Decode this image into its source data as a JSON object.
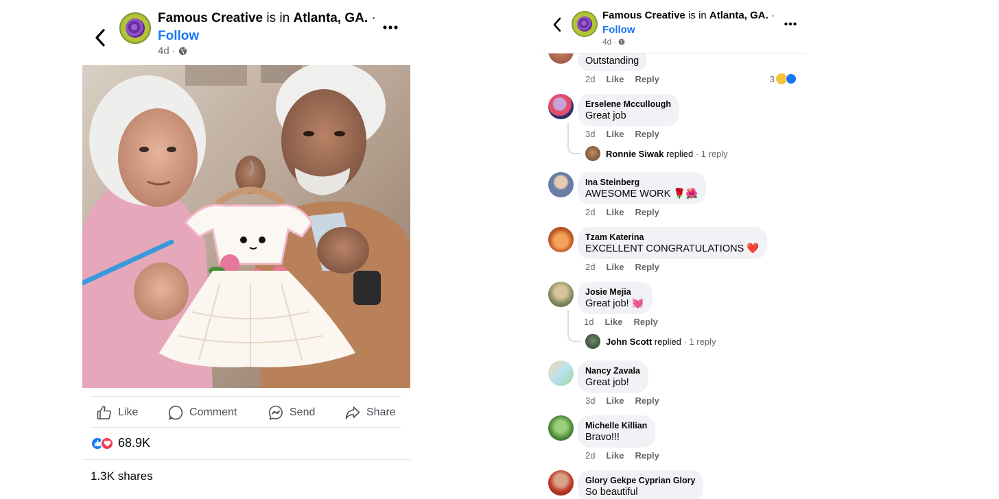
{
  "post": {
    "author": "Famous Creative",
    "location_prefix": "is in",
    "location": "Atlanta, GA.",
    "dot": "·",
    "follow_label": "Follow",
    "time": "4d",
    "dot2": "·",
    "actions": {
      "like": "Like",
      "comment": "Comment",
      "send": "Send",
      "share": "Share"
    },
    "reaction_count": "68.9K",
    "shares": "1.3K shares"
  },
  "comments_panel": {
    "header": {
      "author": "Famous Creative",
      "location_prefix": "is in",
      "location": "Atlanta, GA.",
      "dot": "·",
      "follow_label": "Follow",
      "time": "4d",
      "dot2": "·"
    },
    "like_label": "Like",
    "reply_label": "Reply",
    "comments": [
      {
        "name": "",
        "text": "Outstanding",
        "time": "2d",
        "reactions": "3"
      },
      {
        "name": "Erselene Mccullough",
        "text": "Great job",
        "time": "3d",
        "reply": {
          "name": "Ronnie Siwak",
          "action": "replied",
          "dot": "·",
          "count": "1 reply"
        }
      },
      {
        "name": "Ina Steinberg",
        "text": "AWESOME WORK 🌹🌺",
        "time": "2d"
      },
      {
        "name": "Tzam Katerina",
        "text": "EXCELLENT CONGRATULATIONS ❤️",
        "time": "2d"
      },
      {
        "name": "Josie Mejia",
        "text": "Great job! 💓",
        "time": "1d",
        "reply": {
          "name": "John Scott",
          "action": "replied",
          "dot": "·",
          "count": "1 reply"
        }
      },
      {
        "name": "Nancy Zavala",
        "text": "Great job!",
        "time": "3d"
      },
      {
        "name": "Michelle Killian",
        "text": "Bravo!!!",
        "time": "2d"
      },
      {
        "name": "Glory Gekpe Cyprian Glory",
        "text": "So beautiful",
        "time": ""
      }
    ]
  }
}
